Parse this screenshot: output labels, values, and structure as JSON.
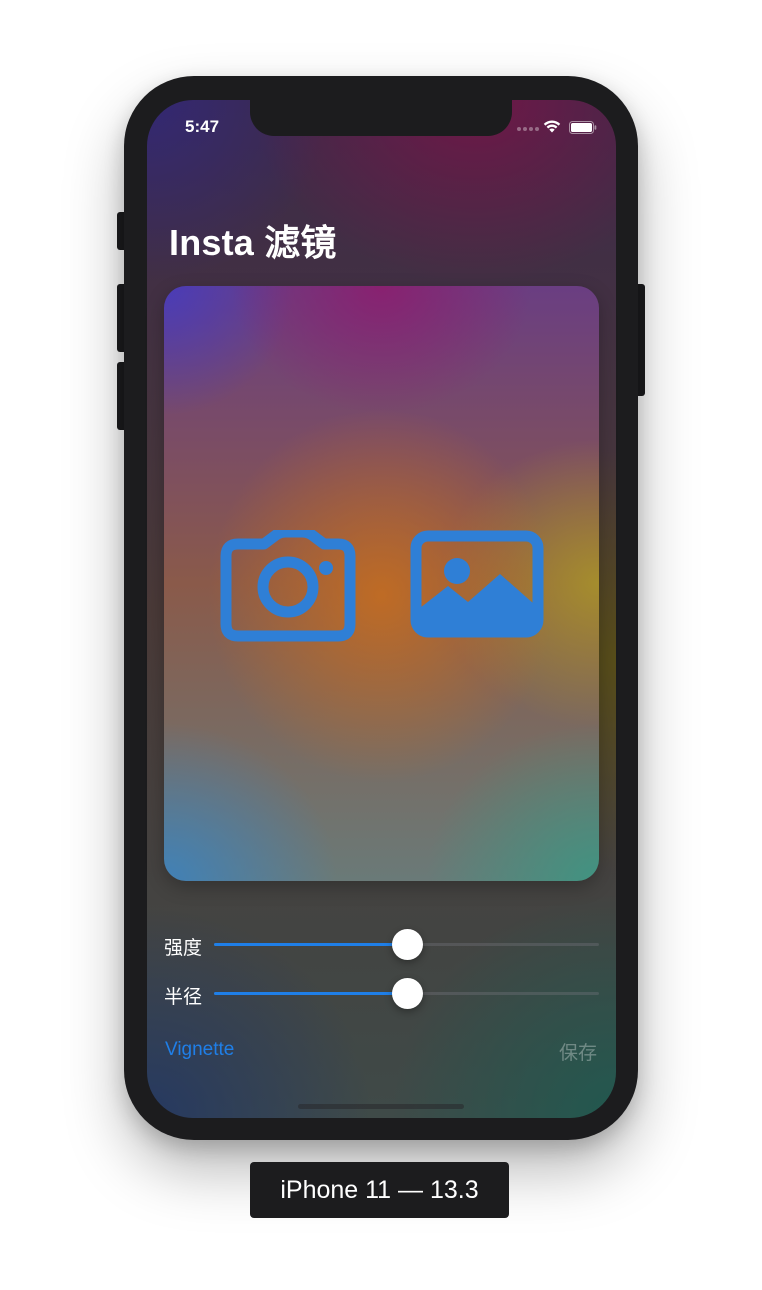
{
  "status_bar": {
    "time": "5:47",
    "icons": [
      "cellular-signal-icon",
      "wifi-icon",
      "battery-icon"
    ]
  },
  "app": {
    "title": "Insta 滤镜"
  },
  "picker": {
    "camera_icon": "camera-icon",
    "library_icon": "photo-library-icon",
    "icon_color": "#2f7fd6"
  },
  "sliders": [
    {
      "label": "强度",
      "value": 0.5
    },
    {
      "label": "半径",
      "value": 0.5
    }
  ],
  "toolbar": {
    "filter_label": "Vignette",
    "save_label": "保存"
  },
  "device_caption": "iPhone 11 — 13.3",
  "colors": {
    "accent": "#1f7fe8",
    "disabled_text": "rgba(255,255,255,0.32)"
  }
}
